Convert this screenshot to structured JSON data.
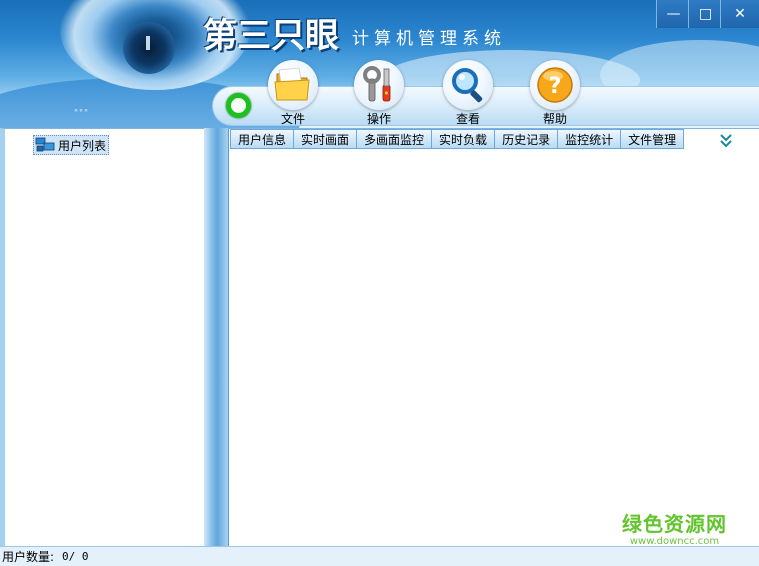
{
  "app": {
    "brand": "第三只眼",
    "subtitle": "计算机管理系统"
  },
  "window_controls": {
    "minimize": "—",
    "maximize": "□",
    "close": "✕"
  },
  "toolbar": {
    "items": [
      {
        "label": "文件",
        "icon": "folder-icon"
      },
      {
        "label": "操作",
        "icon": "tools-icon"
      },
      {
        "label": "查看",
        "icon": "magnifier-icon"
      },
      {
        "label": "帮助",
        "icon": "help-icon"
      }
    ]
  },
  "tree": {
    "root_label": "用户列表",
    "icon": "network-computers-icon"
  },
  "tabs": [
    {
      "label": "用户信息"
    },
    {
      "label": "实时画面"
    },
    {
      "label": "多画面监控"
    },
    {
      "label": "实时负载"
    },
    {
      "label": "历史记录"
    },
    {
      "label": "监控统计"
    },
    {
      "label": "文件管理"
    }
  ],
  "status": {
    "label": "用户数量:",
    "value": "0/ 0"
  },
  "watermark": {
    "title": "绿色资源网",
    "url": "www.downcc.com"
  },
  "colors": {
    "header_blue": "#2b86cf",
    "tab_border": "#6ea8da",
    "ring_green": "#1fbf1f",
    "watermark_green": "#62c42e"
  }
}
